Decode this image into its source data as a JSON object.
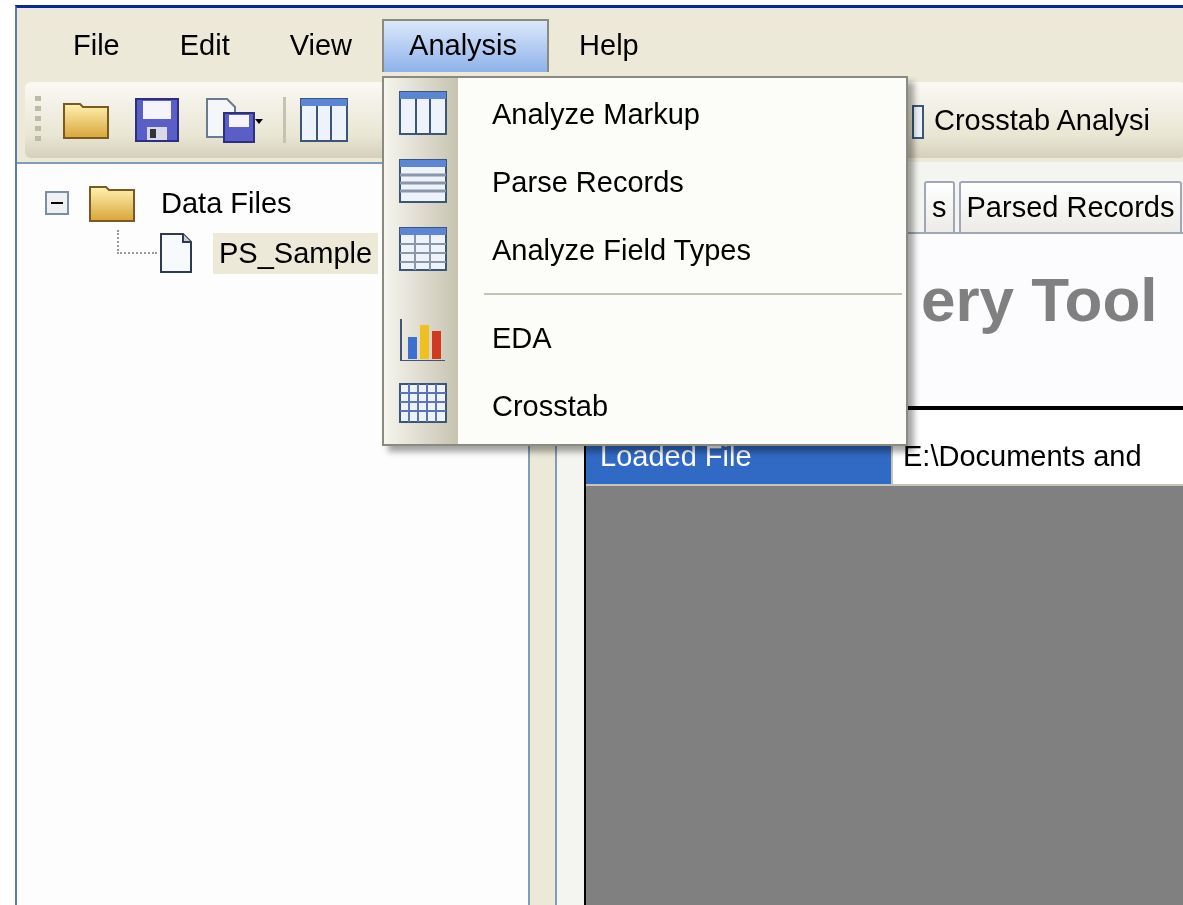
{
  "menu_bar": [
    {
      "label": "File",
      "selected": false
    },
    {
      "label": "Edit",
      "selected": false
    },
    {
      "label": "View",
      "selected": false
    },
    {
      "label": "Analysis",
      "selected": true
    },
    {
      "label": "Help",
      "selected": false
    }
  ],
  "toolbar": {
    "label": "Crosstab Analysi"
  },
  "tree": [
    {
      "label": "Data Files",
      "expanded": true,
      "selected": false,
      "children": [
        {
          "label": "PS_Sample",
          "selected": true
        }
      ]
    }
  ],
  "tabs": [
    {
      "label": "s",
      "selected": false
    },
    {
      "label": "Parsed Records",
      "selected": false
    }
  ],
  "heading": "ery Tool",
  "properties": [
    {
      "name": "Loaded File",
      "value": "E:\\Documents and",
      "selected": true
    }
  ],
  "dropdown": {
    "items": [
      {
        "kind": "item",
        "label": "Analyze Markup"
      },
      {
        "kind": "item",
        "label": "Parse Records"
      },
      {
        "kind": "item",
        "label": "Analyze Field Types"
      },
      {
        "kind": "separator"
      },
      {
        "kind": "item",
        "label": "EDA"
      },
      {
        "kind": "item",
        "label": "Crosstab"
      }
    ]
  }
}
